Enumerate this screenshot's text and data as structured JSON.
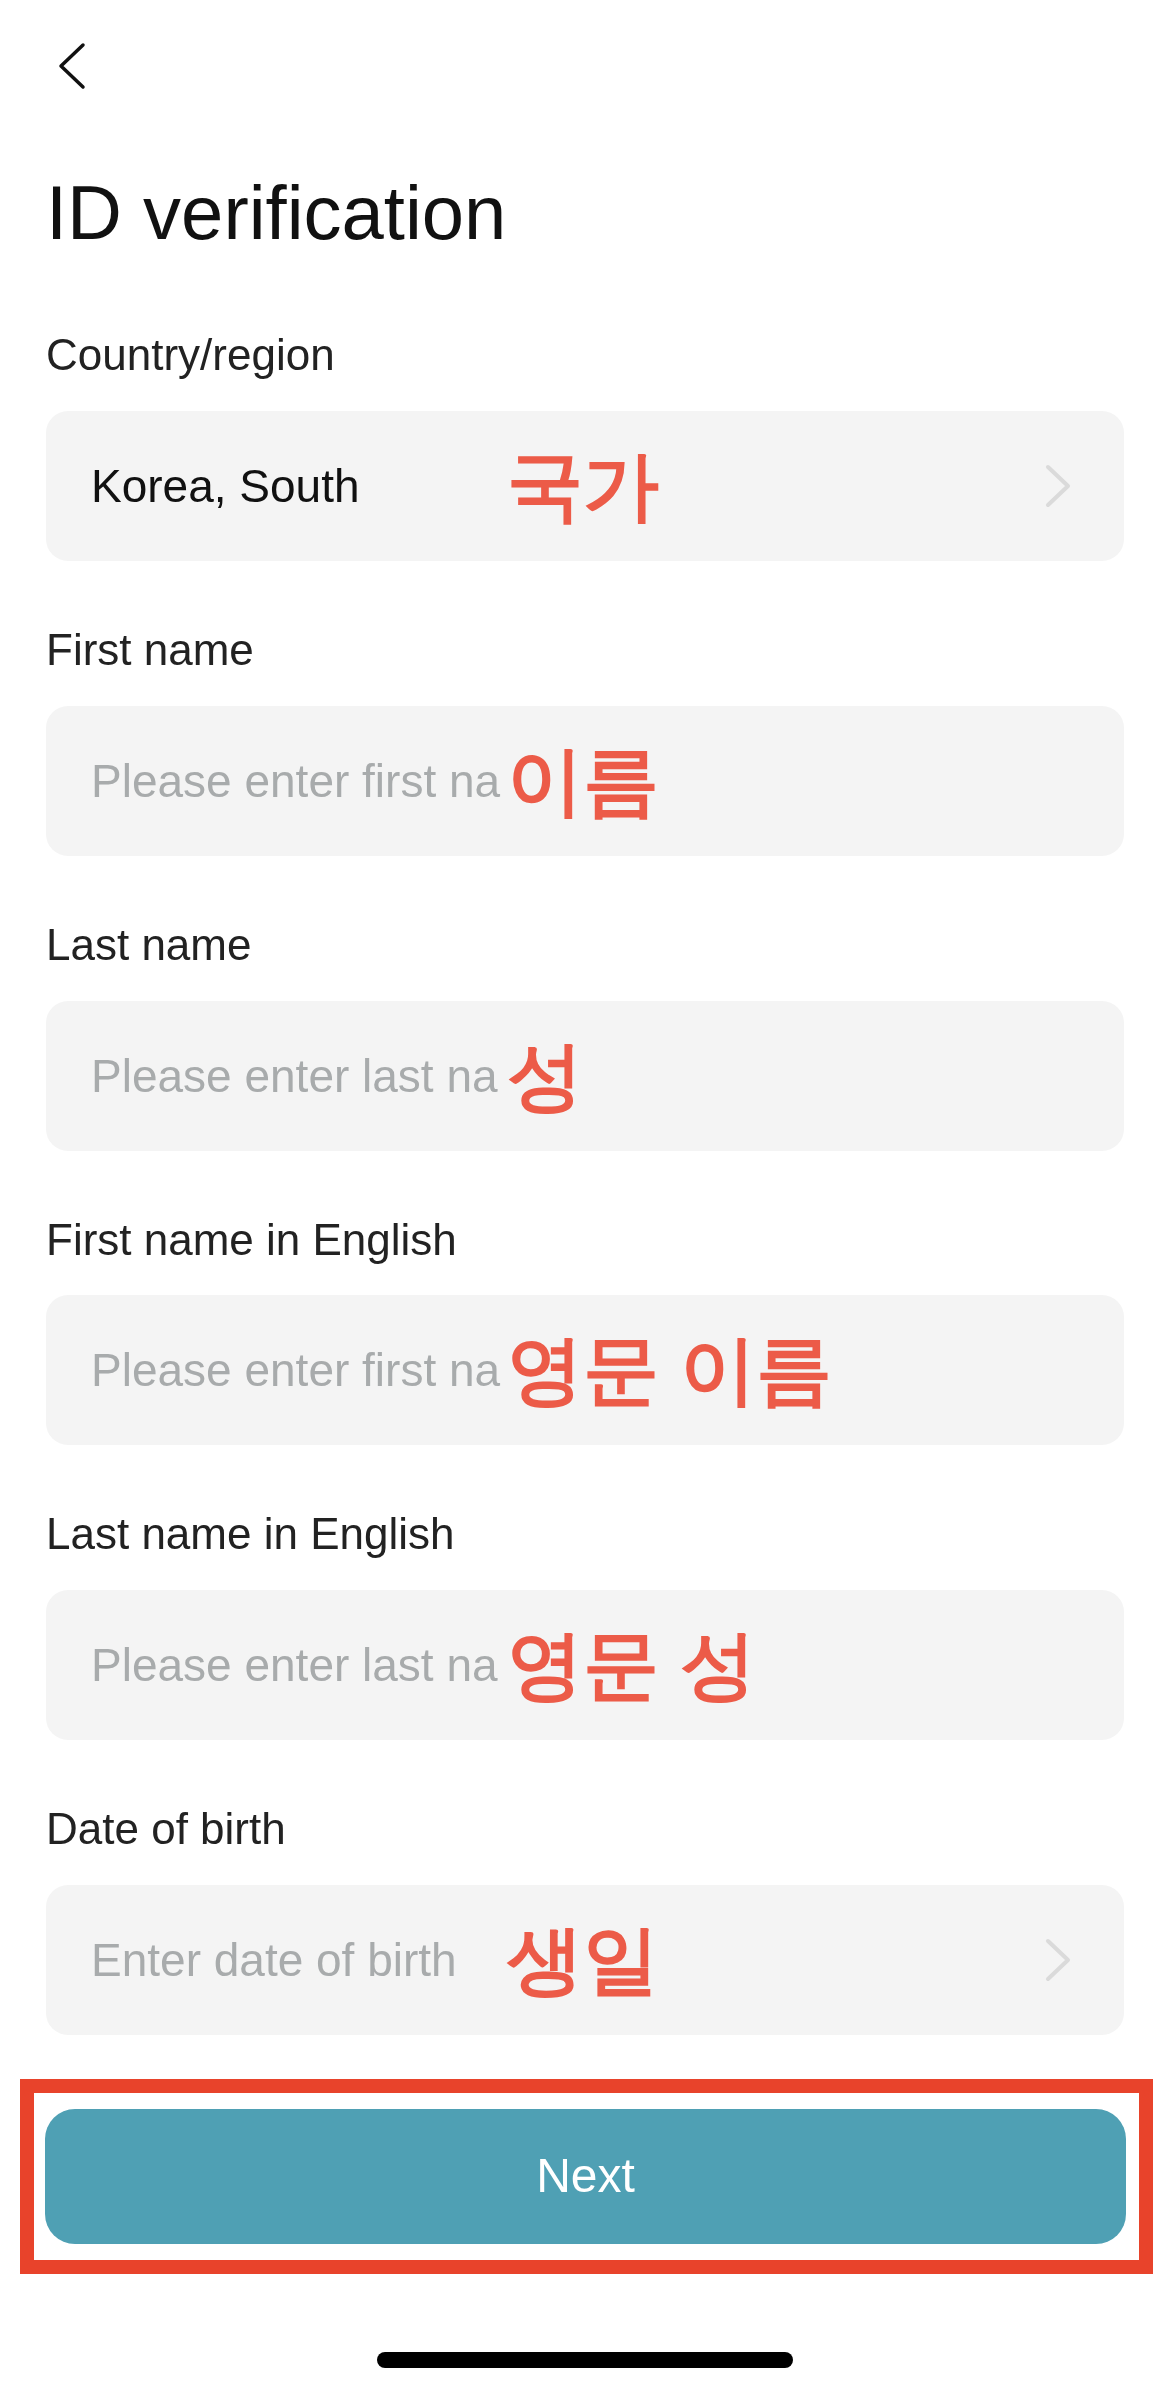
{
  "title": "ID verification",
  "fields": [
    {
      "label": "Country/region",
      "kind": "picker",
      "value": "Korea, South",
      "annotation": "국가"
    },
    {
      "label": "First name",
      "kind": "text",
      "placeholder": "Please enter first na",
      "annotation": "이름"
    },
    {
      "label": "Last name",
      "kind": "text",
      "placeholder": "Please enter last na",
      "annotation": "성"
    },
    {
      "label": "First name in English",
      "kind": "text",
      "placeholder": "Please enter first na",
      "annotation": "영문 이름"
    },
    {
      "label": "Last name in English",
      "kind": "text",
      "placeholder": "Please enter last na",
      "annotation": "영문 성"
    },
    {
      "label": "Date of birth",
      "kind": "picker",
      "placeholder": "Enter date of birth",
      "annotation": "생일"
    }
  ],
  "next_button": {
    "label": "Next",
    "highlighted": true
  }
}
